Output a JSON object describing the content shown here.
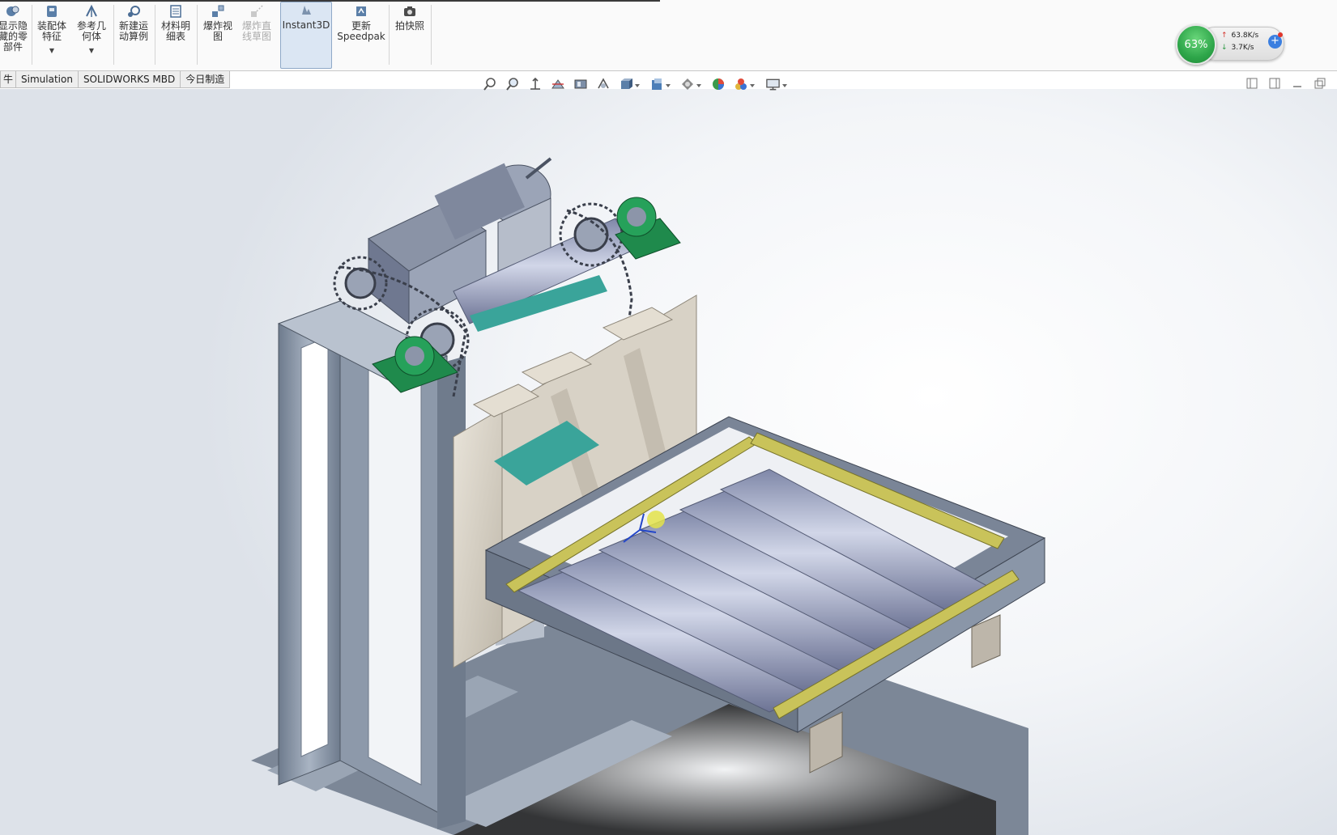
{
  "ribbon": {
    "buttons": [
      {
        "label": "显示隐\n藏的零\n部件",
        "icon": "show-hidden-components-icon",
        "state": "normal"
      },
      {
        "label": "装配体\n特征",
        "icon": "assembly-features-icon",
        "state": "normal",
        "dropdown": true
      },
      {
        "label": "参考几\n何体",
        "icon": "reference-geometry-icon",
        "state": "normal",
        "dropdown": true
      },
      {
        "label": "新建运\n动算例",
        "icon": "new-motion-study-icon",
        "state": "normal"
      },
      {
        "label": "材料明\n细表",
        "icon": "bill-of-materials-icon",
        "state": "normal"
      },
      {
        "label": "爆炸视\n图",
        "icon": "exploded-view-icon",
        "state": "normal"
      },
      {
        "label": "爆炸直\n线草图",
        "icon": "explode-line-sketch-icon",
        "state": "disabled"
      },
      {
        "label": "Instant3D",
        "icon": "instant3d-icon",
        "state": "active"
      },
      {
        "label": "更新\nSpeedpak",
        "icon": "update-speedpak-icon",
        "state": "normal"
      },
      {
        "label": "拍快照",
        "icon": "take-snapshot-icon",
        "state": "normal"
      }
    ]
  },
  "tabs": [
    {
      "label": "牛"
    },
    {
      "label": "Simulation"
    },
    {
      "label": "SOLIDWORKS MBD"
    },
    {
      "label": "今日制造"
    }
  ],
  "heads_up_toolbar": [
    "zoom-to-fit-icon",
    "zoom-to-area-icon",
    "previous-view-icon",
    "section-view-icon",
    "dynamic-annotation-icon",
    "view-orientation-icon",
    "display-style-icon",
    "hide-show-items-icon",
    "edit-appearance-icon",
    "apply-scene-icon",
    "view-settings-icon"
  ],
  "window_controls": [
    "tile-left-icon",
    "tile-right-icon",
    "minimize-icon",
    "restore-icon"
  ],
  "speed_widget": {
    "percent": "63%",
    "upload": "63.8K/s",
    "download": "3.7K/s",
    "colors": {
      "ring": "#2ea64a",
      "up_arrow": "#d4342c",
      "down_arrow": "#2d9a45",
      "plus": "#3b7fe0"
    }
  },
  "model": {
    "description_icon": "roller-conveyor-lift-assembly-icon",
    "colors": {
      "frame": "#8c9aac",
      "plate": "#d8d2c6",
      "rollers": "#9ea6c4",
      "accent_bar": "#c9c35a",
      "bearing": "#1f8a4c",
      "plastic": "#b5561e",
      "teal": "#3aa49a"
    }
  }
}
